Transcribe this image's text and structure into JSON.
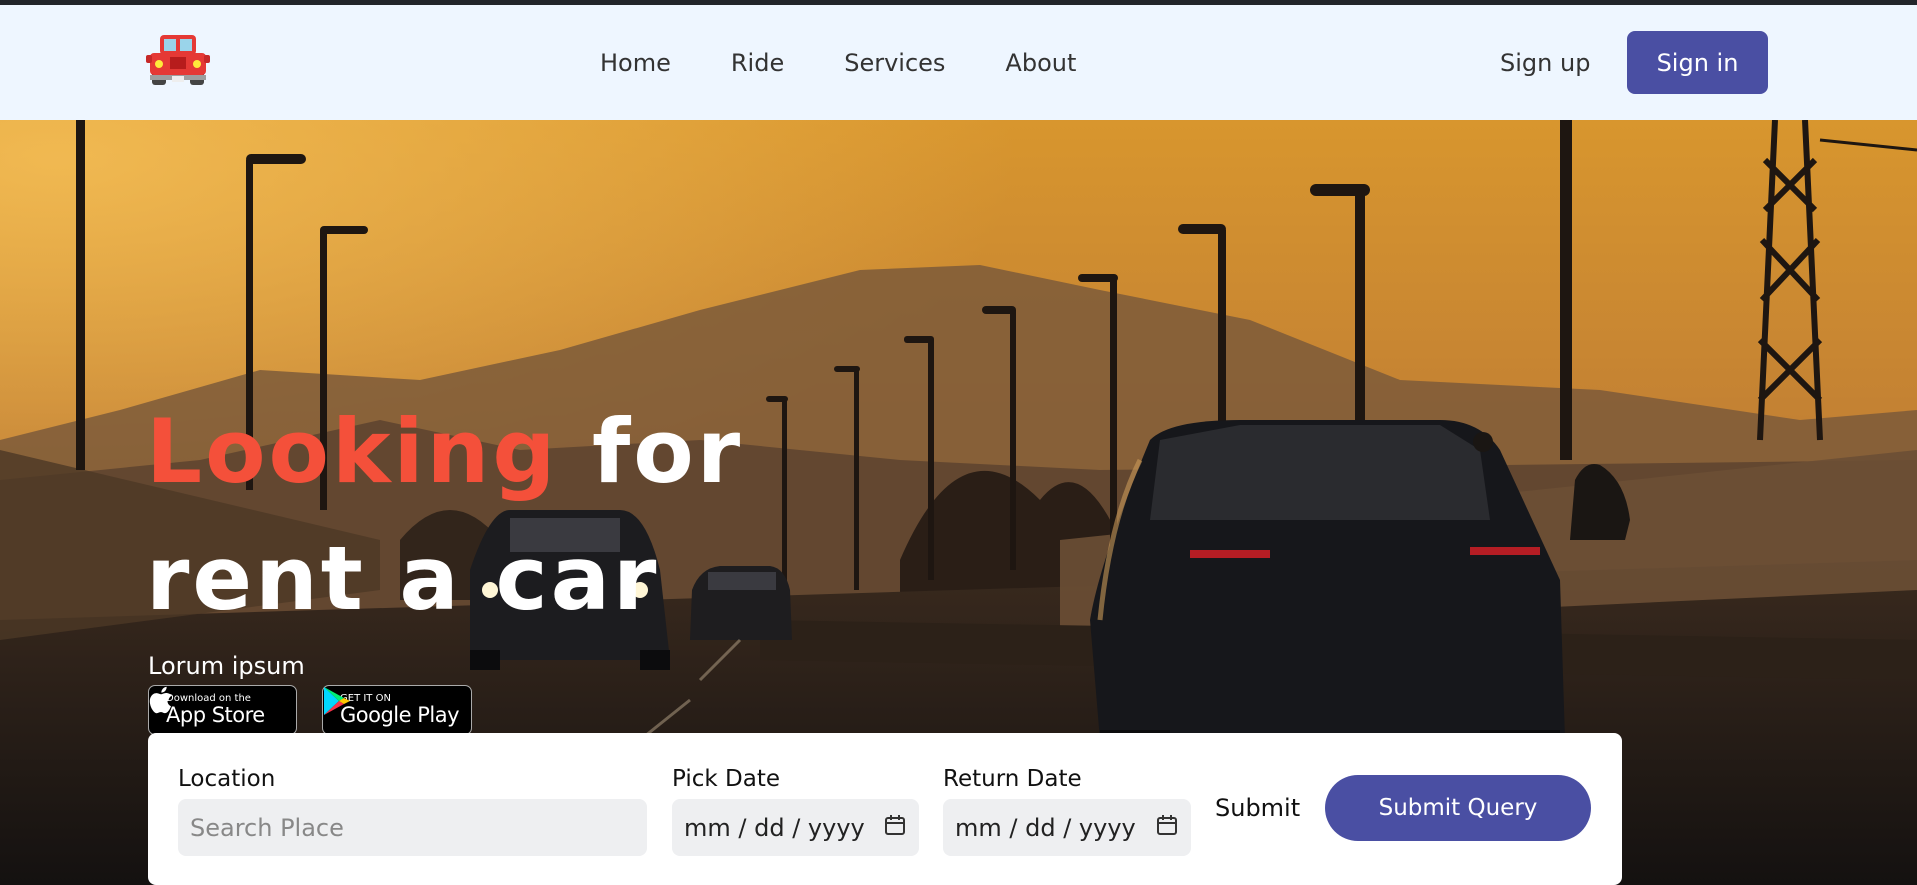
{
  "nav": {
    "logo_icon": "red-jeep-icon",
    "links": [
      "Home",
      "Ride",
      "Services",
      "About"
    ],
    "signup": "Sign up",
    "signin": "Sign in"
  },
  "hero": {
    "headline_accent": "Looking",
    "headline_rest": " for",
    "headline_line2": "rent a car",
    "subtitle": "Lorum ipsum",
    "app_store": {
      "small": "Download on the",
      "big": "App Store",
      "icon": "apple-icon"
    },
    "google_play": {
      "small": "GET IT ON",
      "big": "Google Play",
      "icon": "google-play-icon"
    }
  },
  "form": {
    "location_label": "Location",
    "location_placeholder": "Search Place",
    "pick_label": "Pick Date",
    "pick_value": "mm / dd / yyyy",
    "return_label": "Return Date",
    "return_value": "mm / dd / yyyy",
    "submit_label": "Submit",
    "submit_button": "Submit Query"
  },
  "colors": {
    "accent": "#f4503a",
    "primary": "#4a4fa3",
    "nav_bg": "#eef6ff"
  }
}
